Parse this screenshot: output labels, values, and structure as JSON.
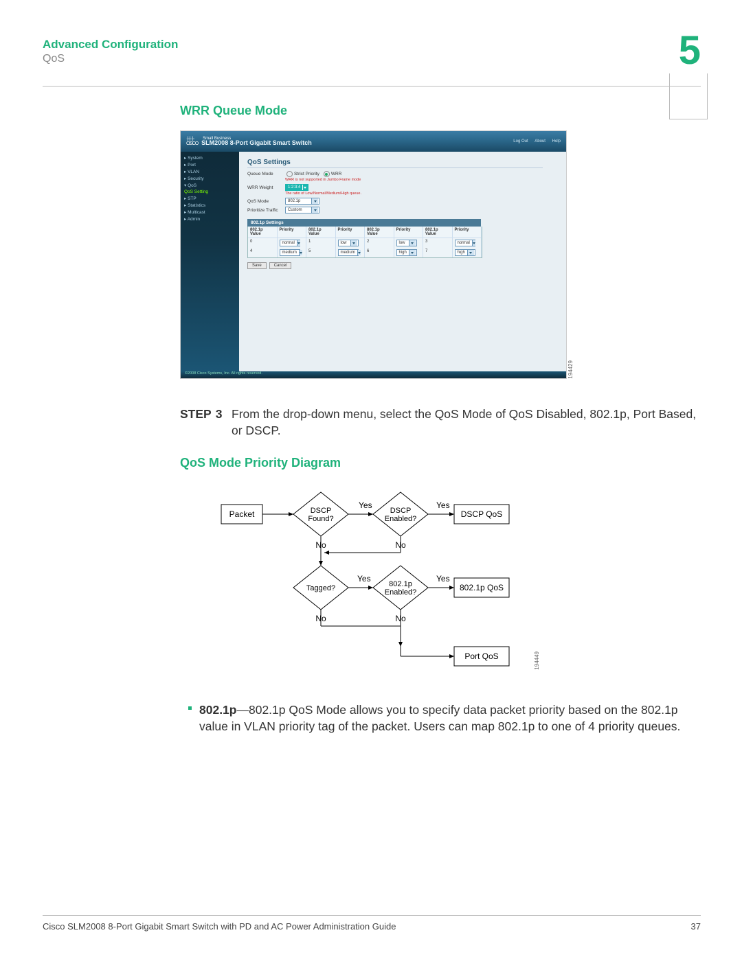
{
  "header": {
    "section": "Advanced Configuration",
    "subtitle": "QoS",
    "chapter_number": "5"
  },
  "subheadings": {
    "wrr": "WRR Queue Mode",
    "priority_diagram": "QoS Mode Priority Diagram"
  },
  "screenshot": {
    "brand_top": "Small Business",
    "product_title": "SLM2008 8-Port Gigabit Smart Switch",
    "top_links": [
      "Log Out",
      "About",
      "Help"
    ],
    "nav": [
      "▸ System",
      "▸ Port",
      "▸ VLAN",
      "▸ Security",
      "▾ QoS",
      "  QoS Setting",
      "▸ STP",
      "▸ Statistics",
      "▸ Multicast",
      "▸ Admin"
    ],
    "nav_active_index": 5,
    "panel_title": "QoS Settings",
    "fields": {
      "queue_mode_label": "Queue Mode",
      "queue_mode_opt1": "Strict Priority",
      "queue_mode_opt2": "WRR",
      "queue_mode_hint": "WRR is not supported in Jumbo Frame mode",
      "wrr_weight_label": "WRR Weight",
      "wrr_weight_value": "1:2:3:4",
      "wrr_weight_hint": "The ratio of Low/Normal/Medium/High queue.",
      "qos_mode_label": "QoS Mode",
      "qos_mode_value": "802.1p",
      "prioritize_label": "Prioritize Traffic",
      "prioritize_value": "Custom"
    },
    "table_title": "802.1p Settings",
    "table_headers": [
      "802.1p Value",
      "Priority",
      "802.1p Value",
      "Priority",
      "802.1p Value",
      "Priority",
      "802.1p Value",
      "Priority"
    ],
    "table_rows": [
      [
        "0",
        "normal",
        "1",
        "low",
        "2",
        "low",
        "3",
        "normal"
      ],
      [
        "4",
        "medium",
        "5",
        "medium",
        "6",
        "high",
        "7",
        "high"
      ]
    ],
    "buttons": [
      "Save",
      "Cancel"
    ],
    "copyright": "©2008 Cisco Systems, Inc. All rights reserved.",
    "image_number": "194429"
  },
  "step": {
    "label_word": "STEP",
    "label_num": "3",
    "text": "From the drop-down menu, select the QoS Mode of QoS Disabled, 802.1p, Port Based, or DSCP."
  },
  "diagram": {
    "packet": "Packet",
    "dscp_found": "DSCP Found?",
    "dscp_enabled": "DSCP Enabled?",
    "dscp_qos": "DSCP QoS",
    "tagged": "Tagged?",
    "dot1p_enabled": "802.1p Enabled?",
    "dot1p_qos": "802.1p QoS",
    "port_qos": "Port QoS",
    "yes": "Yes",
    "no": "No",
    "image_number": "194449"
  },
  "bullet": {
    "lead": "802.1p",
    "text": "—802.1p QoS Mode allows you to specify data packet priority based on the 802.1p value in VLAN priority tag of the packet. Users can map 802.1p to one of 4 priority queues."
  },
  "footer": {
    "doc": "Cisco SLM2008 8-Port Gigabit Smart Switch with PD and AC Power Administration Guide",
    "page": "37"
  }
}
